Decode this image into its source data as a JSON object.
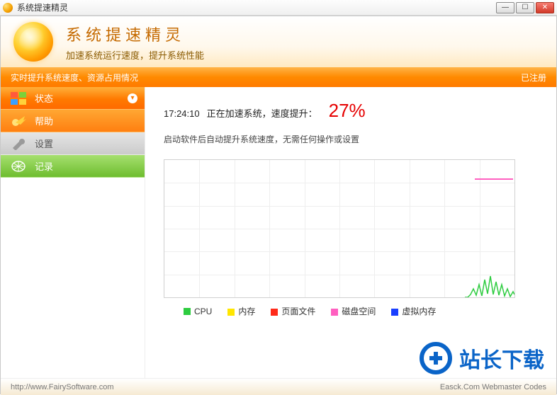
{
  "window": {
    "title": "系统提速精灵"
  },
  "banner": {
    "title": "系统提速精灵",
    "subtitle": "加速系统运行速度，提升系统性能"
  },
  "bar": {
    "left": "实时提升系统速度、资源占用情况",
    "right": "已注册"
  },
  "sidebar": {
    "items": [
      {
        "label": "状态",
        "icon": "windows-icon"
      },
      {
        "label": "帮助",
        "icon": "comet-icon"
      },
      {
        "label": "设置",
        "icon": "wrench-icon"
      },
      {
        "label": "记录",
        "icon": "net-icon"
      }
    ]
  },
  "status": {
    "time": "17:24:10",
    "text": "正在加速系统，速度提升：",
    "percent": "27%",
    "hint": "启动软件后自动提升系统速度，无需任何操作或设置"
  },
  "chart_data": {
    "type": "line",
    "title": "",
    "xlabel": "",
    "ylabel": "",
    "xlim": [
      0,
      100
    ],
    "ylim": [
      0,
      100
    ],
    "grid": true,
    "legend_position": "bottom",
    "series": [
      {
        "name": "CPU",
        "color": "#2ecc40",
        "values": [
          0,
          0,
          0,
          0,
          0,
          0,
          0,
          0,
          0,
          0,
          0,
          0,
          0,
          0,
          0,
          0,
          0,
          0,
          0,
          0,
          0,
          0,
          4,
          12,
          3,
          18,
          2,
          25,
          5,
          30,
          4,
          22,
          3,
          18,
          2
        ]
      },
      {
        "name": "内存",
        "color": "#ffe600",
        "values": []
      },
      {
        "name": "页面文件",
        "color": "#ff2a1a",
        "values": []
      },
      {
        "name": "磁盘空间",
        "color": "#ff5fc0",
        "values": [
          86,
          86,
          86,
          86,
          86,
          86,
          86,
          86,
          86,
          86,
          86
        ]
      },
      {
        "name": "虚拟内存",
        "color": "#1a3fff",
        "values": []
      }
    ]
  },
  "legend": {
    "items": [
      {
        "label": "CPU",
        "color": "#2ecc40"
      },
      {
        "label": "内存",
        "color": "#ffe600"
      },
      {
        "label": "页面文件",
        "color": "#ff2a1a"
      },
      {
        "label": "磁盘空间",
        "color": "#ff5fc0"
      },
      {
        "label": "虚拟内存",
        "color": "#1a3fff"
      }
    ]
  },
  "footer": {
    "url": "http://www.FairySoftware.com",
    "right": "Easck.Com Webmaster Codes"
  },
  "overlay": {
    "brand": "站长下载"
  }
}
